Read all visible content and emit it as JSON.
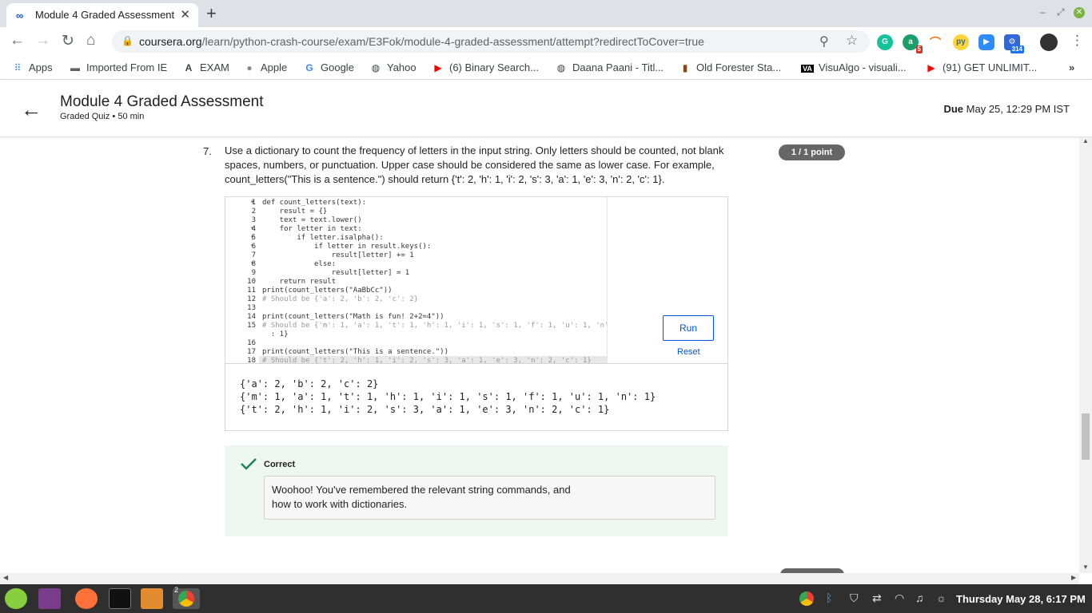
{
  "browser": {
    "tab_title": "Module 4 Graded Assessment",
    "tab_icon": "coursera-icon",
    "url_host": "coursera.org",
    "url_path": "/learn/python-crash-course/exam/E3Fok/module-4-graded-assessment/attempt?redirectToCover=true",
    "extension_badge_1": "5",
    "extension_badge_2": "314"
  },
  "bookmarks": [
    {
      "label": "Apps",
      "icon": "apps-grid-icon"
    },
    {
      "label": "Imported From IE",
      "icon": "folder-icon"
    },
    {
      "label": "EXAM",
      "icon": "a-logo-icon"
    },
    {
      "label": "Apple",
      "icon": "apple-icon"
    },
    {
      "label": "Google",
      "icon": "google-icon"
    },
    {
      "label": "Yahoo",
      "icon": "globe-icon"
    },
    {
      "label": "(6) Binary Search...",
      "icon": "youtube-icon"
    },
    {
      "label": "Daana Paani - Titl...",
      "icon": "globe-icon"
    },
    {
      "label": "Old Forester Sta...",
      "icon": "bottle-icon"
    },
    {
      "label": "VisuAlgo - visuali...",
      "icon": "visualgo-icon"
    },
    {
      "label": "(91) GET UNLIMIT...",
      "icon": "youtube-icon"
    }
  ],
  "header": {
    "title": "Module 4 Graded Assessment",
    "subtitle": "Graded Quiz • 50 min",
    "due_label": "Due",
    "due_value": "May 25, 12:29 PM IST"
  },
  "question": {
    "number": "7.",
    "text": "Use a dictionary to count the frequency of letters in the input string. Only letters should be counted, not blank spaces, numbers, or punctuation. Upper case should be considered the same as lower case. For example, count_letters(\"This is a sentence.\") should return {'t': 2, 'h': 1, 'i': 2, 's': 3, 'a': 1, 'e': 3, 'n': 2, 'c': 1}.",
    "points": "1 / 1 point"
  },
  "editor": {
    "line_numbers": [
      "1",
      "2",
      "3",
      "4",
      "5",
      "6",
      "7",
      "8",
      "9",
      "10",
      "11",
      "12",
      "13",
      "14",
      "15",
      "",
      "16",
      "17",
      "18"
    ],
    "code_lines": [
      "def count_letters(text):",
      "    result = {}",
      "    text = text.lower()",
      "    for letter in text:",
      "        if letter.isalpha():",
      "            if letter in result.keys():",
      "                result[letter] += 1",
      "            else:",
      "                result[letter] = 1",
      "    return result",
      "print(count_letters(\"AaBbCc\"))",
      "# Should be {'a': 2, 'b': 2, 'c': 2}",
      "",
      "print(count_letters(\"Math is fun! 2+2=4\"))",
      "# Should be {'m': 1, 'a': 1, 't': 1, 'h': 1, 'i': 1, 's': 1, 'f': 1, 'u': 1, 'n'",
      "  : 1}",
      "",
      "print(count_letters(\"This is a sentence.\"))",
      "# Should be {'t': 2, 'h': 1, 'i': 2, 's': 3, 'a': 1, 'e': 3, 'n': 2, 'c': 1}"
    ],
    "run_label": "Run",
    "reset_label": "Reset",
    "output_lines": [
      "{'a': 2, 'b': 2, 'c': 2}",
      "{'m': 1, 'a': 1, 't': 1, 'h': 1, 'i': 1, 's': 1, 'f': 1, 'u': 1, 'n': 1}",
      "{'t': 2, 'h': 1, 'i': 2, 's': 3, 'a': 1, 'e': 3, 'n': 2, 'c': 1}"
    ]
  },
  "feedback": {
    "status": "Correct",
    "message": "Woohoo! You've remembered the relevant string commands, and how to work with dictionaries."
  },
  "taskbar": {
    "clock": "Thursday May 28,  6:17 PM",
    "workspace_badge": "2"
  },
  "colors": {
    "accent": "#0056d2",
    "success": "#1f8354",
    "feedback_bg": "#eef6f1"
  }
}
